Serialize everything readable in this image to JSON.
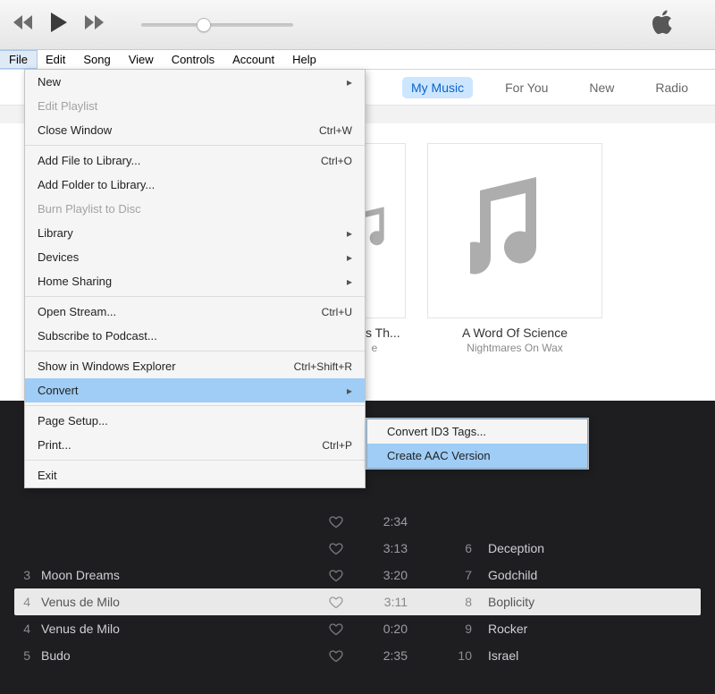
{
  "menubar": [
    "File",
    "Edit",
    "Song",
    "View",
    "Controls",
    "Account",
    "Help"
  ],
  "menubar_open_index": 0,
  "tabs": {
    "items": [
      "My Music",
      "For You",
      "New",
      "Radio"
    ],
    "active_index": 0
  },
  "albums": [
    {
      "title": "ings Th...",
      "artist": "e"
    },
    {
      "title": "A Word Of Science",
      "artist": "Nightmares On Wax"
    }
  ],
  "dropdown": {
    "sections": [
      [
        {
          "label": "New",
          "type": "submenu"
        },
        {
          "label": "Edit Playlist",
          "disabled": true
        },
        {
          "label": "Close Window",
          "shortcut": "Ctrl+W"
        }
      ],
      [
        {
          "label": "Add File to Library...",
          "shortcut": "Ctrl+O"
        },
        {
          "label": "Add Folder to Library..."
        },
        {
          "label": "Burn Playlist to Disc",
          "disabled": true
        },
        {
          "label": "Library",
          "type": "submenu"
        },
        {
          "label": "Devices",
          "type": "submenu"
        },
        {
          "label": "Home Sharing",
          "type": "submenu"
        }
      ],
      [
        {
          "label": "Open Stream...",
          "shortcut": "Ctrl+U"
        },
        {
          "label": "Subscribe to Podcast..."
        }
      ],
      [
        {
          "label": "Show in Windows Explorer",
          "shortcut": "Ctrl+Shift+R"
        },
        {
          "label": "Convert",
          "type": "submenu",
          "highlight": true
        }
      ],
      [
        {
          "label": "Page Setup..."
        },
        {
          "label": "Print...",
          "shortcut": "Ctrl+P"
        }
      ],
      [
        {
          "label": "Exit"
        }
      ]
    ]
  },
  "submenu": {
    "items": [
      {
        "label": "Convert ID3 Tags..."
      },
      {
        "label": "Create AAC Version",
        "highlight": true
      }
    ]
  },
  "tracks_left": [
    {
      "num": "",
      "title": "",
      "dur": "2:34"
    },
    {
      "num": "",
      "title": "",
      "dur": "3:13"
    },
    {
      "num": "3",
      "title": "Moon Dreams",
      "dur": "3:20"
    },
    {
      "num": "4",
      "title": "Venus de Milo",
      "dur": "3:11",
      "selected": true
    },
    {
      "num": "4",
      "title": "Venus de Milo",
      "dur": "0:20"
    },
    {
      "num": "5",
      "title": "Budo",
      "dur": "2:35"
    }
  ],
  "tracks_right": [
    {
      "num": "6",
      "title": "Deception"
    },
    {
      "num": "7",
      "title": "Godchild"
    },
    {
      "num": "8",
      "title": "Boplicity"
    },
    {
      "num": "9",
      "title": "Rocker"
    },
    {
      "num": "10",
      "title": "Israel"
    }
  ],
  "colors": {
    "highlight": "#9fcdf6",
    "dark": "#1e1e21"
  }
}
